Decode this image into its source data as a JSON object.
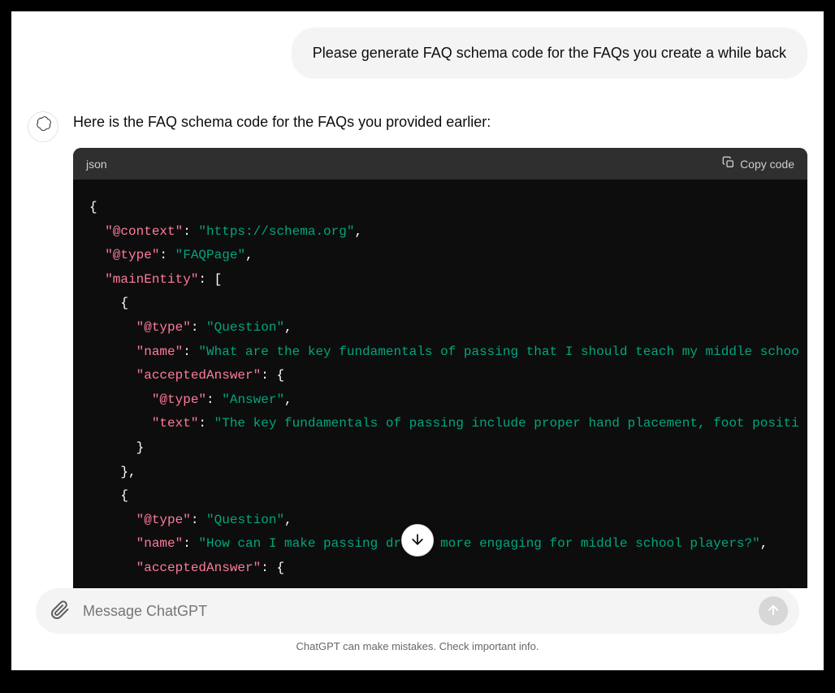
{
  "user_message": "Please generate FAQ schema code for the FAQs you create a while back",
  "assistant_intro": "Here is the FAQ schema code for the FAQs you provided earlier:",
  "code_block": {
    "language": "json",
    "copy_label": "Copy code",
    "tokens": [
      {
        "t": "punct",
        "v": "{"
      },
      {
        "t": "nl"
      },
      {
        "t": "indent",
        "v": 1
      },
      {
        "t": "key",
        "v": "\"@context\""
      },
      {
        "t": "punct",
        "v": ": "
      },
      {
        "t": "string",
        "v": "\"https://schema.org\""
      },
      {
        "t": "punct",
        "v": ","
      },
      {
        "t": "nl"
      },
      {
        "t": "indent",
        "v": 1
      },
      {
        "t": "key",
        "v": "\"@type\""
      },
      {
        "t": "punct",
        "v": ": "
      },
      {
        "t": "string",
        "v": "\"FAQPage\""
      },
      {
        "t": "punct",
        "v": ","
      },
      {
        "t": "nl"
      },
      {
        "t": "indent",
        "v": 1
      },
      {
        "t": "key",
        "v": "\"mainEntity\""
      },
      {
        "t": "punct",
        "v": ": ["
      },
      {
        "t": "nl"
      },
      {
        "t": "indent",
        "v": 2
      },
      {
        "t": "punct",
        "v": "{"
      },
      {
        "t": "nl"
      },
      {
        "t": "indent",
        "v": 3
      },
      {
        "t": "key",
        "v": "\"@type\""
      },
      {
        "t": "punct",
        "v": ": "
      },
      {
        "t": "string",
        "v": "\"Question\""
      },
      {
        "t": "punct",
        "v": ","
      },
      {
        "t": "nl"
      },
      {
        "t": "indent",
        "v": 3
      },
      {
        "t": "key",
        "v": "\"name\""
      },
      {
        "t": "punct",
        "v": ": "
      },
      {
        "t": "string",
        "v": "\"What are the key fundamentals of passing that I should teach my middle schoo"
      },
      {
        "t": "nl"
      },
      {
        "t": "indent",
        "v": 3
      },
      {
        "t": "key",
        "v": "\"acceptedAnswer\""
      },
      {
        "t": "punct",
        "v": ": {"
      },
      {
        "t": "nl"
      },
      {
        "t": "indent",
        "v": 4
      },
      {
        "t": "key",
        "v": "\"@type\""
      },
      {
        "t": "punct",
        "v": ": "
      },
      {
        "t": "string",
        "v": "\"Answer\""
      },
      {
        "t": "punct",
        "v": ","
      },
      {
        "t": "nl"
      },
      {
        "t": "indent",
        "v": 4
      },
      {
        "t": "key",
        "v": "\"text\""
      },
      {
        "t": "punct",
        "v": ": "
      },
      {
        "t": "string",
        "v": "\"The key fundamentals of passing include proper hand placement, foot positi"
      },
      {
        "t": "nl"
      },
      {
        "t": "indent",
        "v": 3
      },
      {
        "t": "punct",
        "v": "}"
      },
      {
        "t": "nl"
      },
      {
        "t": "indent",
        "v": 2
      },
      {
        "t": "punct",
        "v": "},"
      },
      {
        "t": "nl"
      },
      {
        "t": "indent",
        "v": 2
      },
      {
        "t": "punct",
        "v": "{"
      },
      {
        "t": "nl"
      },
      {
        "t": "indent",
        "v": 3
      },
      {
        "t": "key",
        "v": "\"@type\""
      },
      {
        "t": "punct",
        "v": ": "
      },
      {
        "t": "string",
        "v": "\"Question\""
      },
      {
        "t": "punct",
        "v": ","
      },
      {
        "t": "nl"
      },
      {
        "t": "indent",
        "v": 3
      },
      {
        "t": "key",
        "v": "\"name\""
      },
      {
        "t": "punct",
        "v": ": "
      },
      {
        "t": "string",
        "v": "\"How can I make passing drills more engaging for middle school players?\""
      },
      {
        "t": "punct",
        "v": ","
      },
      {
        "t": "nl"
      },
      {
        "t": "indent",
        "v": 3
      },
      {
        "t": "key",
        "v": "\"acceptedAnswer\""
      },
      {
        "t": "punct",
        "v": ": {"
      }
    ]
  },
  "input": {
    "placeholder": "Message ChatGPT"
  },
  "footer": "ChatGPT can make mistakes. Check important info."
}
